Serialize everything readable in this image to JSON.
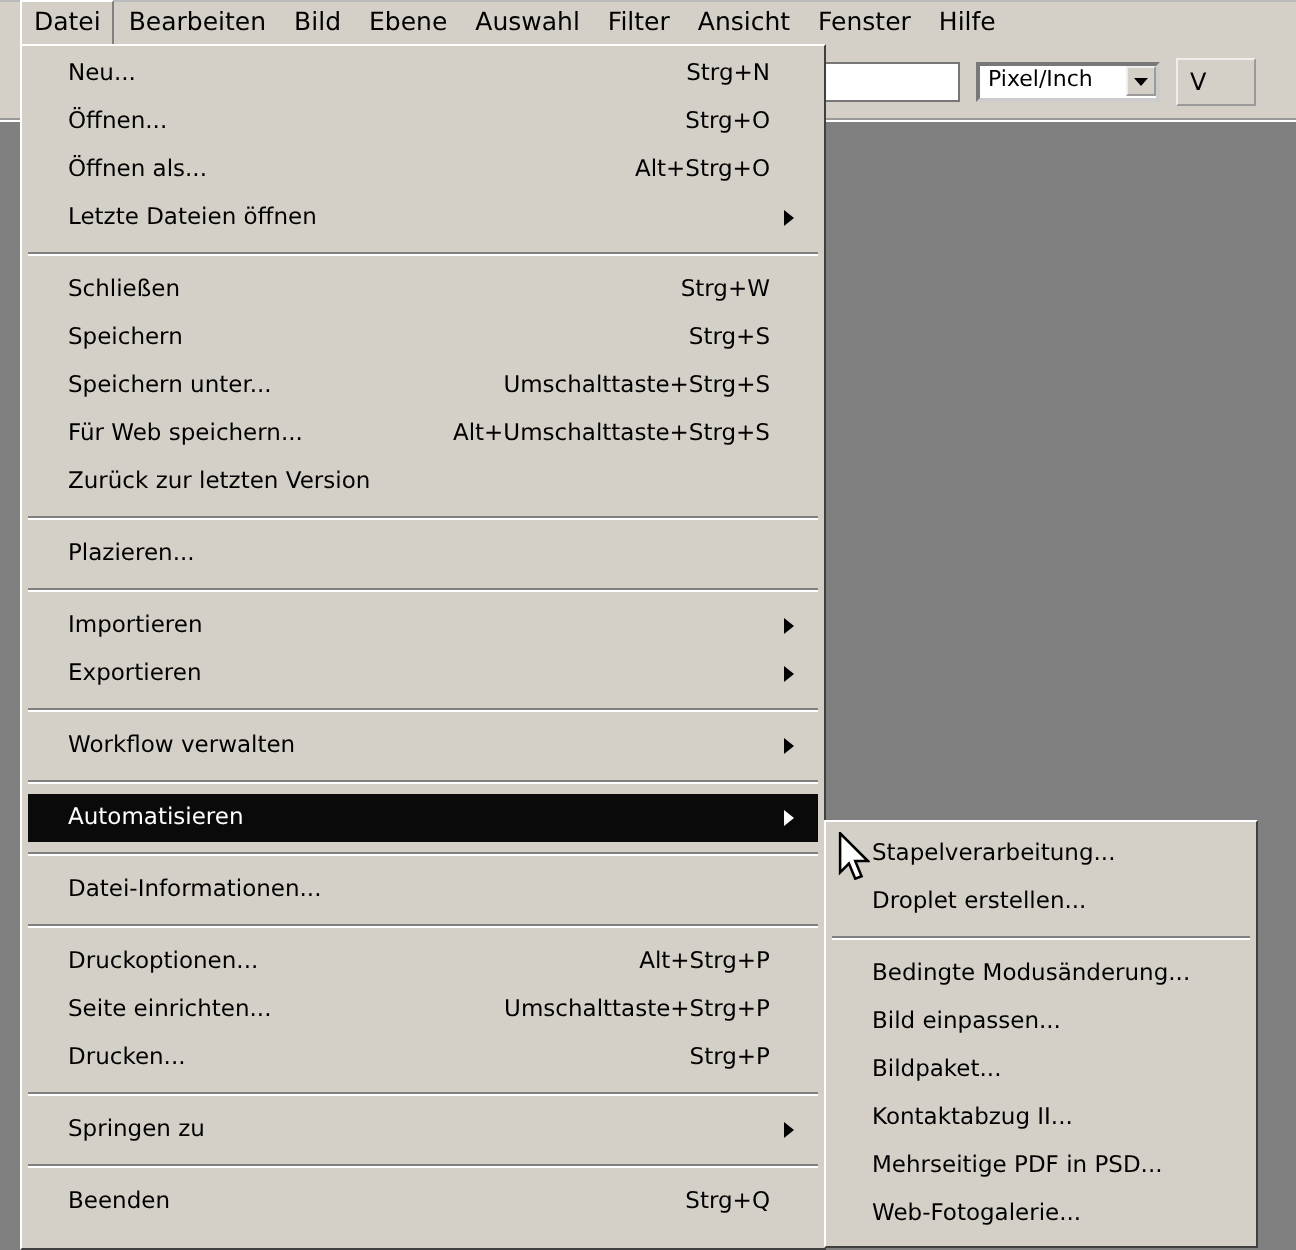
{
  "menubar": [
    {
      "label": "Datei",
      "selected": true
    },
    {
      "label": "Bearbeiten",
      "selected": false
    },
    {
      "label": "Bild",
      "selected": false
    },
    {
      "label": "Ebene",
      "selected": false
    },
    {
      "label": "Auswahl",
      "selected": false
    },
    {
      "label": "Filter",
      "selected": false
    },
    {
      "label": "Ansicht",
      "selected": false
    },
    {
      "label": "Fenster",
      "selected": false
    },
    {
      "label": "Hilfe",
      "selected": false
    }
  ],
  "toolbar": {
    "unit_dropdown": "Pixel/Inch",
    "button": "V"
  },
  "menu": [
    [
      {
        "label": "Neu...",
        "shortcut": "Strg+N",
        "submenu": false,
        "selected": false
      },
      {
        "label": "Öffnen...",
        "shortcut": "Strg+O",
        "submenu": false,
        "selected": false
      },
      {
        "label": "Öffnen als...",
        "shortcut": "Alt+Strg+O",
        "submenu": false,
        "selected": false
      },
      {
        "label": "Letzte Dateien öffnen",
        "submenu": true,
        "selected": false
      }
    ],
    [
      {
        "label": "Schließen",
        "shortcut": "Strg+W",
        "submenu": false,
        "selected": false
      },
      {
        "label": "Speichern",
        "shortcut": "Strg+S",
        "submenu": false,
        "selected": false
      },
      {
        "label": "Speichern unter...",
        "shortcut": "Umschalttaste+Strg+S",
        "submenu": false,
        "selected": false
      },
      {
        "label": "Für Web speichern...",
        "shortcut": "Alt+Umschalttaste+Strg+S",
        "submenu": false,
        "selected": false
      },
      {
        "label": "Zurück zur letzten Version",
        "submenu": false,
        "selected": false
      }
    ],
    [
      {
        "label": "Plazieren...",
        "submenu": false,
        "selected": false
      }
    ],
    [
      {
        "label": "Importieren",
        "submenu": true,
        "selected": false
      },
      {
        "label": "Exportieren",
        "submenu": true,
        "selected": false
      }
    ],
    [
      {
        "label": "Workflow verwalten",
        "submenu": true,
        "selected": false
      }
    ],
    [
      {
        "label": "Automatisieren",
        "submenu": true,
        "selected": true
      }
    ],
    [
      {
        "label": "Datei-Informationen...",
        "submenu": false,
        "selected": false
      }
    ],
    [
      {
        "label": "Druckoptionen...",
        "shortcut": "Alt+Strg+P",
        "submenu": false,
        "selected": false
      },
      {
        "label": "Seite einrichten...",
        "shortcut": "Umschalttaste+Strg+P",
        "submenu": false,
        "selected": false
      },
      {
        "label": "Drucken...",
        "shortcut": "Strg+P",
        "submenu": false,
        "selected": false
      }
    ],
    [
      {
        "label": "Springen zu",
        "submenu": true,
        "selected": false
      }
    ],
    [
      {
        "label": "Beenden",
        "shortcut": "Strg+Q",
        "submenu": false,
        "selected": false
      }
    ]
  ],
  "submenu": [
    [
      "Stapelverarbeitung...",
      "Droplet erstellen..."
    ],
    [
      "Bedingte Modusänderung...",
      "Bild einpassen...",
      "Bildpaket...",
      "Kontaktabzug II...",
      "Mehrseitige PDF in PSD...",
      "Web-Fotogalerie..."
    ]
  ]
}
